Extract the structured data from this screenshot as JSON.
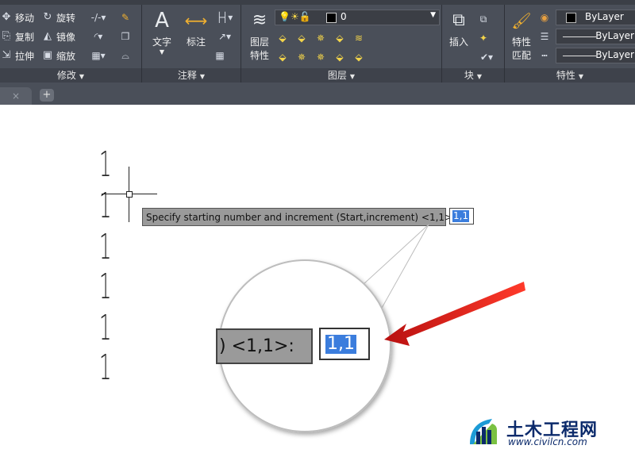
{
  "ribbon": {
    "panels": {
      "modify": {
        "title": "修改",
        "tools": [
          "移动",
          "旋转",
          "复制",
          "镜像",
          "拉伸",
          "缩放"
        ]
      },
      "annotation": {
        "title": "注释",
        "text_label": "文字",
        "dim_label": "标注"
      },
      "layers": {
        "title": "图层",
        "layer_props_label_1": "图层",
        "layer_props_label_2": "特性",
        "current_layer": "0"
      },
      "block": {
        "title": "块",
        "insert_label": "插入"
      },
      "properties": {
        "title": "特性",
        "match_label_1": "特性",
        "match_label_2": "匹配",
        "color": "ByLayer",
        "linetype": "ByLayer",
        "lineweight": "ByLayer"
      }
    }
  },
  "tabbar": {
    "close_glyph": "×",
    "add_glyph": "+"
  },
  "canvas": {
    "numbers": [
      "1",
      "1",
      "1",
      "1",
      "1",
      "1"
    ],
    "prompt": "Specify starting number and increment (Start,increment) <1,1>:",
    "input_value": "1,1",
    "zoom_prompt": ") <1,1>:",
    "zoom_input_value": "1,1"
  },
  "watermark": {
    "name": "土木工程网",
    "url": "www.civilcn.com"
  },
  "colors": {
    "ribbon_bg": "#4a4f59",
    "selection_blue": "#3b7ddd",
    "arrow_red": "#e0231e",
    "tooltip_gray": "#9a9a9a"
  }
}
